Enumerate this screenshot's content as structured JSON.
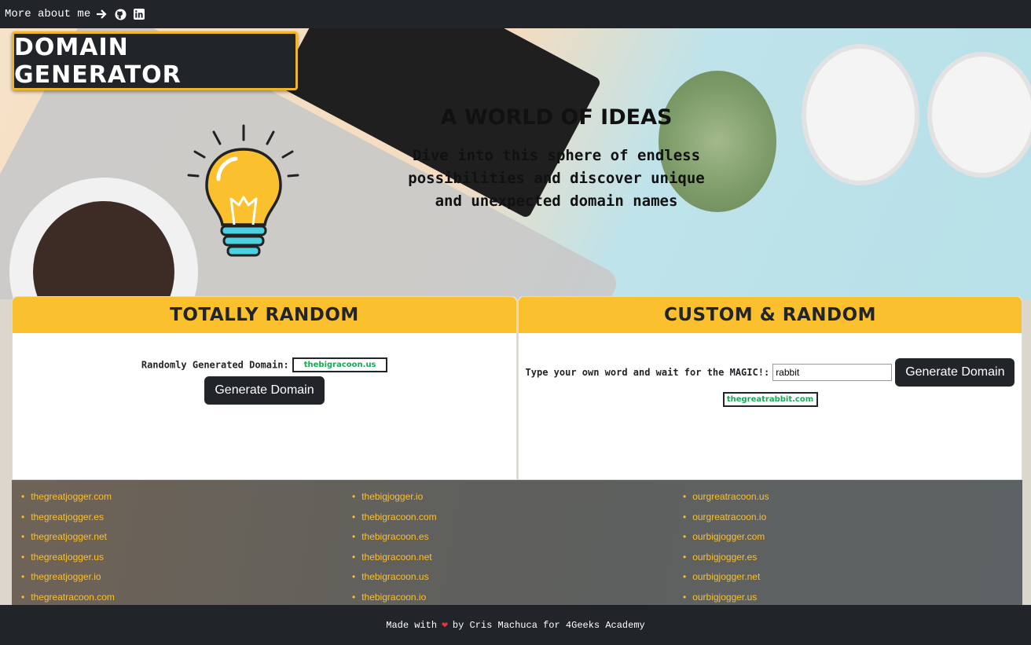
{
  "topbar": {
    "about_label": "More about me"
  },
  "brand": {
    "title": "Domain Generator"
  },
  "hero": {
    "title": "A world of ideas",
    "subtitle": "Dive into this sphere of endless possibilities and discover unique and unexpected domain names"
  },
  "random_card": {
    "title": "Totally Random",
    "label": "Randomly Generated Domain:",
    "result": "thebigracoon.us",
    "button": "Generate Domain"
  },
  "custom_card": {
    "title": "Custom & Random",
    "label": "Type your own word and wait for the MAGIC!:",
    "input_value": "rabbit",
    "button": "Generate Domain",
    "result": "thegreatrabbit.com"
  },
  "domain_columns": [
    [
      "thegreatjogger.com",
      "thegreatjogger.es",
      "thegreatjogger.net",
      "thegreatjogger.us",
      "thegreatjogger.io",
      "thegreatracoon.com"
    ],
    [
      "thebigjogger.io",
      "thebigracoon.com",
      "thebigracoon.es",
      "thebigracoon.net",
      "thebigracoon.us",
      "thebigracoon.io"
    ],
    [
      "ourgreatracoon.us",
      "ourgreatracoon.io",
      "ourbigjogger.com",
      "ourbigjogger.es",
      "ourbigjogger.net",
      "ourbigjogger.us"
    ]
  ],
  "footer": {
    "made_with": "Made with",
    "by": "by Cris Machuca for 4Geeks Academy"
  },
  "icons": {
    "arrow": "arrow-right-icon",
    "github": "github-icon",
    "linkedin": "linkedin-icon",
    "heart": "heart-icon"
  },
  "colors": {
    "accent": "#fbc02d",
    "dark": "#212529",
    "result_green": "#18a957"
  }
}
